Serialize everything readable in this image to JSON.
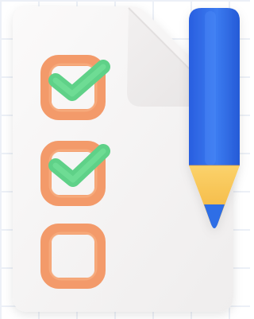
{
  "illustration": {
    "subject": "checklist-with-pencil",
    "checklist_items": [
      {
        "state": "checked"
      },
      {
        "state": "checked"
      },
      {
        "state": "unchecked"
      }
    ],
    "colors": {
      "paper": "#f7f5f5",
      "paper_fold": "#efeded",
      "checkbox": "#f39a6a",
      "checkbox_inner": "#f8b084",
      "checkmark": "#63d98a",
      "pencil_body": "#2f6ee6",
      "pencil_body_highlight": "#4b88f5",
      "pencil_tip_wood": "#f7c247",
      "pencil_graphite": "#2f6ee6"
    }
  }
}
